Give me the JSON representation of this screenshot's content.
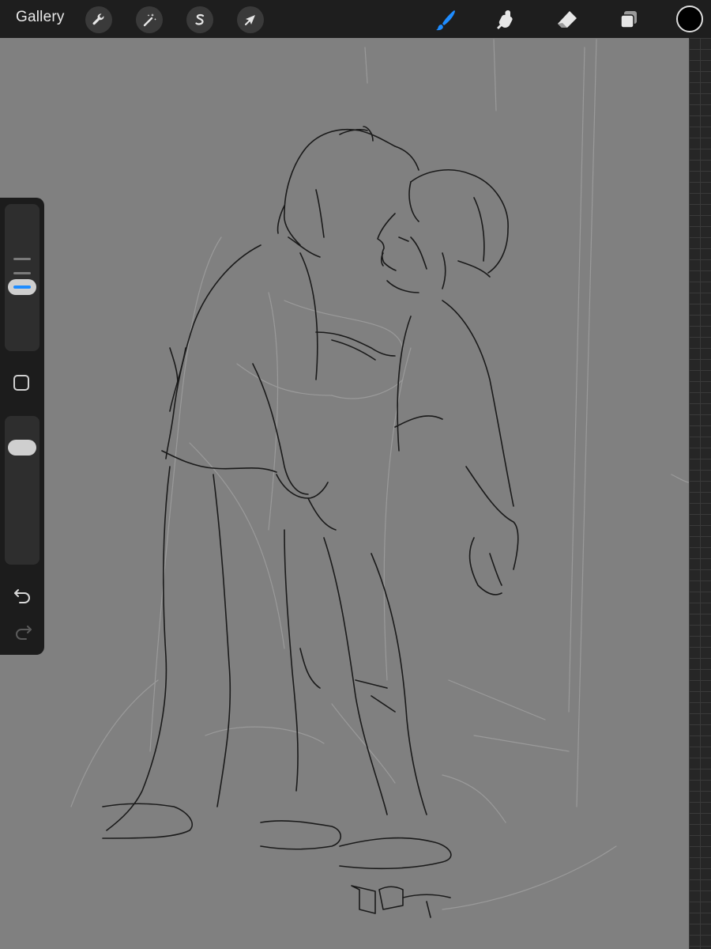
{
  "toolbar": {
    "gallery_label": "Gallery",
    "left_tools": [
      {
        "name": "actions",
        "icon": "wrench-icon"
      },
      {
        "name": "adjustments",
        "icon": "magic-wand-icon"
      },
      {
        "name": "selection",
        "icon": "selection-s-icon"
      },
      {
        "name": "transform",
        "icon": "arrow-cursor-icon"
      }
    ],
    "right_tools": [
      {
        "name": "brush",
        "icon": "brush-icon",
        "active": true
      },
      {
        "name": "smudge",
        "icon": "smudge-finger-icon",
        "active": false
      },
      {
        "name": "eraser",
        "icon": "eraser-icon",
        "active": false
      },
      {
        "name": "layers",
        "icon": "layers-icon",
        "active": false
      }
    ],
    "current_color": "#000000"
  },
  "sidebar": {
    "brush_size_level": 0.45,
    "opacity_level": 0.8,
    "controls": [
      "brush-size-slider",
      "modify-button",
      "opacity-slider",
      "undo-button",
      "redo-button"
    ]
  },
  "colors": {
    "accent": "#1e8cff",
    "canvas": "#808080",
    "toolbar": "#1e1e1e"
  }
}
